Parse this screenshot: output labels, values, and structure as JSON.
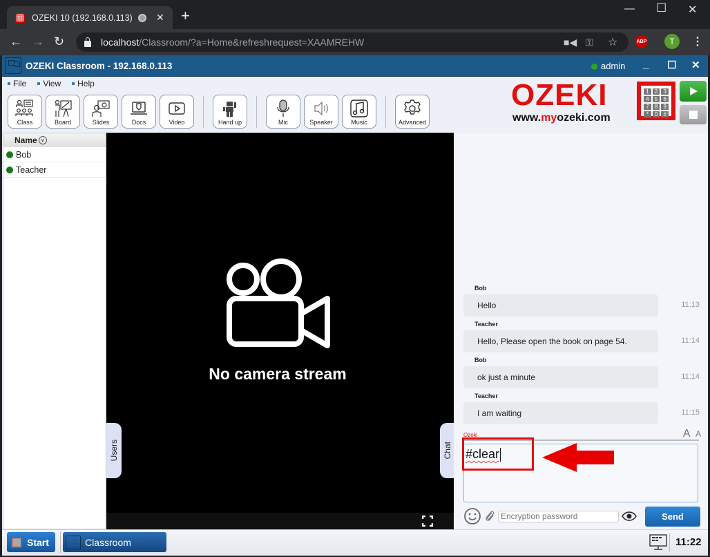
{
  "browser": {
    "tab_title": "OZEKI 10 (192.168.0.113)",
    "url_host": "localhost",
    "url_path": "/Classroom/?a=Home&refreshrequest=XAAMREHW",
    "extension_abp": "ABP",
    "profile_initial": "T"
  },
  "app": {
    "title": "OZEKI Classroom - 192.168.0.113",
    "user": "admin",
    "user_status_color": "#2aa52a",
    "menu": [
      "File",
      "View",
      "Help"
    ],
    "toolbar": [
      {
        "label": "Class",
        "icon": "class-icon"
      },
      {
        "label": "Board",
        "icon": "board-icon"
      },
      {
        "label": "Slides",
        "icon": "slides-icon"
      },
      {
        "label": "Docs",
        "icon": "docs-icon"
      },
      {
        "label": "Video",
        "icon": "video-icon"
      },
      {
        "label": "Hand up",
        "icon": "hand-up-icon"
      },
      {
        "label": "Mic",
        "icon": "mic-icon"
      },
      {
        "label": "Speaker",
        "icon": "speaker-icon"
      },
      {
        "label": "Music",
        "icon": "music-icon"
      },
      {
        "label": "Advanced",
        "icon": "gear-icon"
      }
    ],
    "brand": {
      "name": "OZEKI",
      "www": "www.",
      "my": "my",
      "domain": "ozeki.com",
      "color": "#e01010"
    },
    "keypad": [
      "1",
      "2",
      "3",
      "4",
      "5",
      "6",
      "7",
      "8",
      "9",
      "*",
      "0",
      "#"
    ]
  },
  "users_panel": {
    "header": "Name",
    "users": [
      {
        "name": "Bob",
        "status": "online"
      },
      {
        "name": "Teacher",
        "status": "online"
      }
    ],
    "tab_label": "Users"
  },
  "video": {
    "message": "No camera stream"
  },
  "chat": {
    "tab_label": "Chat",
    "messages": [
      {
        "author": "Bob",
        "text": "Hello",
        "time": "11:13"
      },
      {
        "author": "Teacher",
        "text": "Hello, Please open the book on page 54.",
        "time": "11:14"
      },
      {
        "author": "Bob",
        "text": "ok just a minute",
        "time": "11:14"
      },
      {
        "author": "Teacher",
        "text": "I am waiting",
        "time": "11:15"
      }
    ],
    "current_user": "Ozeki",
    "font_size_labels": [
      "A",
      "A"
    ],
    "input_value": "#clear",
    "encryption_placeholder": "Encryption password",
    "send_label": "Send"
  },
  "taskbar": {
    "start_label": "Start",
    "task_label": "Classroom",
    "clock": "11:22"
  }
}
